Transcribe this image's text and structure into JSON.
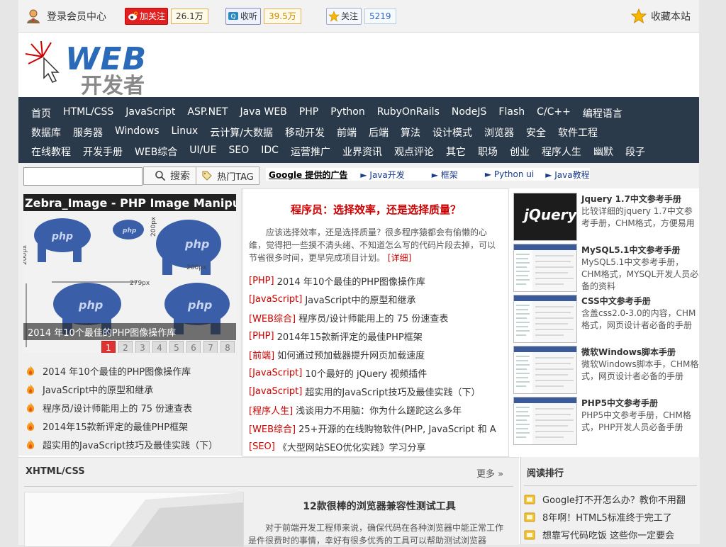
{
  "topbar": {
    "login_label": "登录会员中心",
    "weibo_follow": "加关注",
    "weibo_count": "26.1万",
    "shouting": "收听",
    "shouting_count": "39.5万",
    "star_follow": "关注",
    "star_count": "5219",
    "favorite": "收藏本站"
  },
  "header": {
    "logo_main": "WEB",
    "logo_sub": "开发者"
  },
  "nav": {
    "row1": [
      "首页",
      "HTML/CSS",
      "JavaScript",
      "ASP.NET",
      "Java WEB",
      "PHP",
      "Python",
      "RubyOnRails",
      "NodeJS",
      "Flash",
      "C/C++",
      "编程语言"
    ],
    "row2": [
      "数据库",
      "服务器",
      "Windows",
      "Linux",
      "云计算/大数据",
      "移动开发",
      "前端",
      "后端",
      "算法",
      "设计模式",
      "浏览器",
      "安全",
      "软件工程"
    ],
    "row3": [
      "在线教程",
      "开发手册",
      "WEB综合",
      "UI/UE",
      "SEO",
      "IDC",
      "运营推广",
      "业界资讯",
      "观点评论",
      "其它",
      "职场",
      "创业",
      "程序人生",
      "幽默",
      "段子"
    ]
  },
  "search": {
    "placeholder": "",
    "button": "搜索",
    "tag_button": "热门TAG",
    "ads_label": "Google 提供的广告",
    "ads_links": [
      "► Java开发",
      "► 框架",
      "► Python ui",
      "► Java教程"
    ]
  },
  "slider": {
    "image_title": "Zebra_Image - PHP Image Manipulat",
    "caption": "2014 年10个最佳的PHP图像操作库",
    "pages": [
      "1",
      "2",
      "3",
      "4",
      "5",
      "6",
      "7",
      "8"
    ],
    "image_labels": [
      "php",
      "php",
      "php",
      "php",
      "php",
      "200px",
      "200px",
      "279px",
      "200px"
    ]
  },
  "left_list": [
    "2014 年10个最佳的PHP图像操作库",
    "JavaScript中的原型和继承",
    "程序员/设计师能用上的 75 份速查表",
    "2014年15款新评定的最佳PHP框架",
    "超实用的JavaScript技巧及最佳实践（下）"
  ],
  "feature": {
    "title": "程序员：选择效率，还是选择质量？",
    "desc": "应该选择效率，还是选择质量？很多程序猿都会有偷懒的心维，觉得把一些摸不清头绪、不知道怎么写的代码片段去掉，可以节省很多时间，更早完成项目计划。",
    "more": "[详细]"
  },
  "mid_list": [
    {
      "cat": "[PHP]",
      "title": "2014 年10个最佳的PHP图像操作库"
    },
    {
      "cat": "[JavaScript]",
      "title": "JavaScript中的原型和继承"
    },
    {
      "cat": "[WEB综合]",
      "title": "程序员/设计师能用上的 75 份速查表"
    },
    {
      "cat": "[PHP]",
      "title": "2014年15款新评定的最佳PHP框架"
    },
    {
      "cat": "[前端]",
      "title": "如何通过预加载器提升网页加载速度"
    },
    {
      "cat": "[JavaScript]",
      "title": "10个最好的 jQuery 视频插件"
    },
    {
      "cat": "[JavaScript]",
      "title": "超实用的JavaScript技巧及最佳实践（下）"
    },
    {
      "cat": "[程序人生]",
      "title": "浅谈用力不用脑：你为什么蹉跎这么多年"
    },
    {
      "cat": "[WEB综合]",
      "title": "25+开源的在线购物软件(PHP, JavaScript 和 A"
    },
    {
      "cat": "[SEO]",
      "title": "《大型网站SEO优化实践》学习分享"
    }
  ],
  "manuals": [
    {
      "title": "Jquery 1.7中文参考手册",
      "desc": "比较详细的jquery 1.7中文参考手册，CHM格式，方便易用",
      "thumb": "jQuery"
    },
    {
      "title": "MySQL5.1中文参考手册",
      "desc": "MySQL5.1中文参考手册，CHM格式，MYSQL开发人员必备的资料",
      "thumb": ""
    },
    {
      "title": "CSS中文参考手册",
      "desc": "含盖css2.0-3.0的内容，CHM格式，网页设计者必备的手册",
      "thumb": ""
    },
    {
      "title": "微软Windows脚本手册",
      "desc": "微软Windows脚本手，CHM格式，网页设计者必备的手册",
      "thumb": ""
    },
    {
      "title": "PHP5中文参考手册",
      "desc": "PHP5中文参考手册，CHM格式，PHP开发人员必备手册",
      "thumb": ""
    }
  ],
  "xhtml_section": {
    "title": "XHTML/CSS",
    "more": "更多 »",
    "article_title": "12款很棒的浏览器兼容性测试工具",
    "article_desc": "对于前端开发工程师来说，确保代码在各种浏览器中能正常工作是件很费时的事情，幸好有很多优秀的工具可以帮助测试浏览器"
  },
  "ranking": {
    "title": "阅读排行",
    "items": [
      "Google打不开怎么办？教你不用翻",
      "8年啊！HTML5标准终于完工了",
      "想靠写代码吃饭 这些你一定要会"
    ]
  },
  "colors": {
    "nav_bg": "#2b3a4a",
    "accent_red": "#cc0000",
    "link_blue": "#1a3a8a"
  }
}
